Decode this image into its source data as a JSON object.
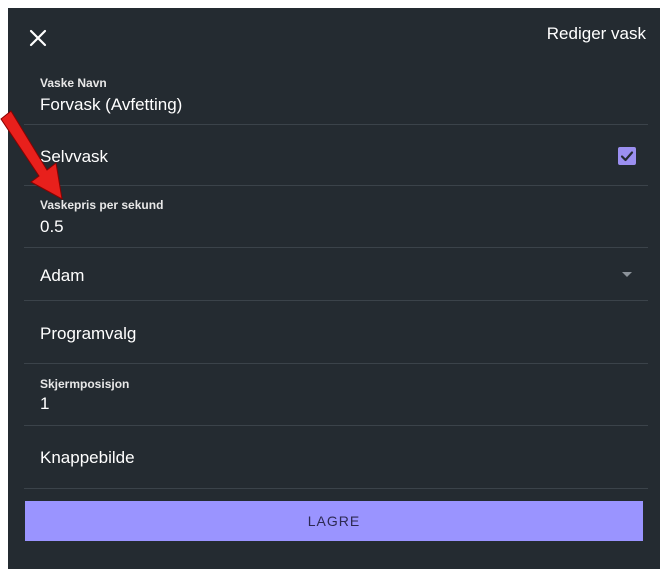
{
  "header": {
    "title": "Rediger vask",
    "close_icon": "close-icon"
  },
  "form": {
    "wash_name": {
      "label": "Vaske Navn",
      "value": "Forvask (Avfetting)"
    },
    "self_wash": {
      "label": "Selvvask",
      "checked": true
    },
    "price_per_second": {
      "label": "Vaskepris per sekund",
      "value": "0.5"
    },
    "machine": {
      "selected": "Adam"
    },
    "program_choice": {
      "label": "Programvalg"
    },
    "screen_position": {
      "label": "Skjermposisjon",
      "value": "1"
    },
    "button_image": {
      "label": "Knappebilde"
    }
  },
  "actions": {
    "save_label": "LAGRE"
  },
  "colors": {
    "panel_bg": "#242b31",
    "accent": "#9a94ff",
    "checkbox": "#9b8ff0",
    "annotation_arrow": "#e8201c"
  }
}
